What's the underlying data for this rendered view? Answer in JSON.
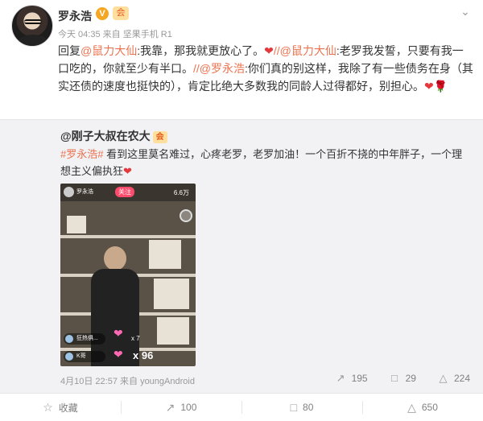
{
  "post": {
    "author": "罗永浩",
    "verified_mark": "V",
    "vip_mark": "会",
    "time": "今天 04:35",
    "source_prefix": "来自",
    "source": "坚果手机 R1",
    "reply_prefix": "回复",
    "mention1": "@鼠力大仙",
    "text1": ":我靠，那我就更放心了。",
    "sep1": "//",
    "mention2": "@鼠力大仙",
    "text2": ":老罗我发誓，只要有我一口吃的，你就至少有半口。",
    "sep2": "//",
    "mention3": "@罗永浩",
    "text3": ":你们真的别这样，我除了有一些债务在身（其实还债的速度也挺快的），肯定比绝大多数我的同龄人过得都好，别担心。",
    "heart": "❤",
    "rose": "🌹"
  },
  "repost": {
    "author": "@刚子大叔在农大",
    "vip_mark": "会",
    "topic": "#罗永浩#",
    "text": " 看到这里莫名难过，心疼老罗，老罗加油！一个百折不挠的中年胖子，一个理想主义偏执狂",
    "heart": "❤",
    "video": {
      "host_name": "罗永浩",
      "follow_label": "关注",
      "viewer_count": "6.6万",
      "chat1": "狂热俱...",
      "chat2": "K哥",
      "gift_small": "x 7",
      "gift_count": "x 96"
    },
    "time": "4月10日 22:57",
    "source_prefix": "来自",
    "source": "youngAndroid",
    "repost_count": "195",
    "comment_count": "29",
    "like_count": "224"
  },
  "bottom_bar": {
    "favorite_label": "收藏",
    "repost_count": "100",
    "comment_count": "80",
    "like_count": "650"
  },
  "icons": {
    "menu": "chevron-down-icon",
    "repost": "repost-icon",
    "comment": "comment-icon",
    "like": "like-icon",
    "favorite": "star-icon"
  }
}
